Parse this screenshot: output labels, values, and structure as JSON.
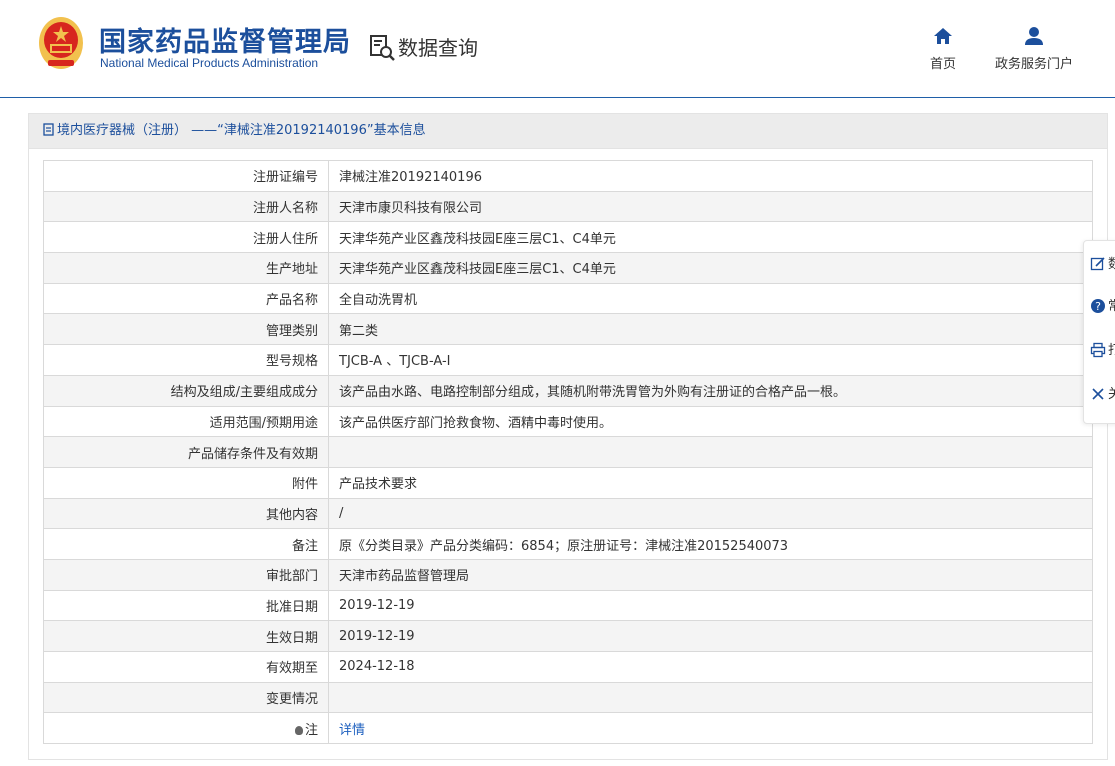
{
  "header": {
    "brand_cn": "国家药品监督管理局",
    "brand_en": "National Medical Products Administration",
    "query_label": "数据查询",
    "nav": {
      "home": "首页",
      "portal": "政务服务门户"
    }
  },
  "panel": {
    "title": "境内医疗器械（注册） ——“津械注准20192140196”基本信息"
  },
  "rows": [
    {
      "label": "注册证编号",
      "value": "津械注准20192140196"
    },
    {
      "label": "注册人名称",
      "value": "天津市康贝科技有限公司"
    },
    {
      "label": "注册人住所",
      "value": "天津华苑产业区鑫茂科技园E座三层C1、C4单元"
    },
    {
      "label": "生产地址",
      "value": "天津华苑产业区鑫茂科技园E座三层C1、C4单元"
    },
    {
      "label": "产品名称",
      "value": "全自动洗胃机"
    },
    {
      "label": "管理类别",
      "value": "第二类"
    },
    {
      "label": "型号规格",
      "value": "TJCB-A 、TJCB-A-I"
    },
    {
      "label": "结构及组成/主要组成成分",
      "value": "该产品由水路、电路控制部分组成，其随机附带洗胃管为外购有注册证的合格产品一根。"
    },
    {
      "label": "适用范围/预期用途",
      "value": "该产品供医疗部门抢救食物、酒精中毒时使用。"
    },
    {
      "label": "产品储存条件及有效期",
      "value": ""
    },
    {
      "label": "附件",
      "value": "产品技术要求"
    },
    {
      "label": "其他内容",
      "value": "/"
    },
    {
      "label": "备注",
      "value": "原《分类目录》产品分类编码：6854；原注册证号：津械注准20152540073"
    },
    {
      "label": "审批部门",
      "value": "天津市药品监督管理局"
    },
    {
      "label": "批准日期",
      "value": "2019-12-19"
    },
    {
      "label": "生效日期",
      "value": "2019-12-19"
    },
    {
      "label": "有效期至",
      "value": "2024-12-18"
    },
    {
      "label": "变更情况",
      "value": ""
    }
  ],
  "note_row": {
    "label": "注",
    "link": "详情"
  },
  "side_toolbar": {
    "edit": "数",
    "help": "常",
    "print": "打",
    "close": "关"
  },
  "colors": {
    "brand_blue": "#1c4f9c",
    "link_blue": "#1c5fbf",
    "emblem_red": "#d7261e",
    "emblem_gold": "#f2c14e"
  }
}
